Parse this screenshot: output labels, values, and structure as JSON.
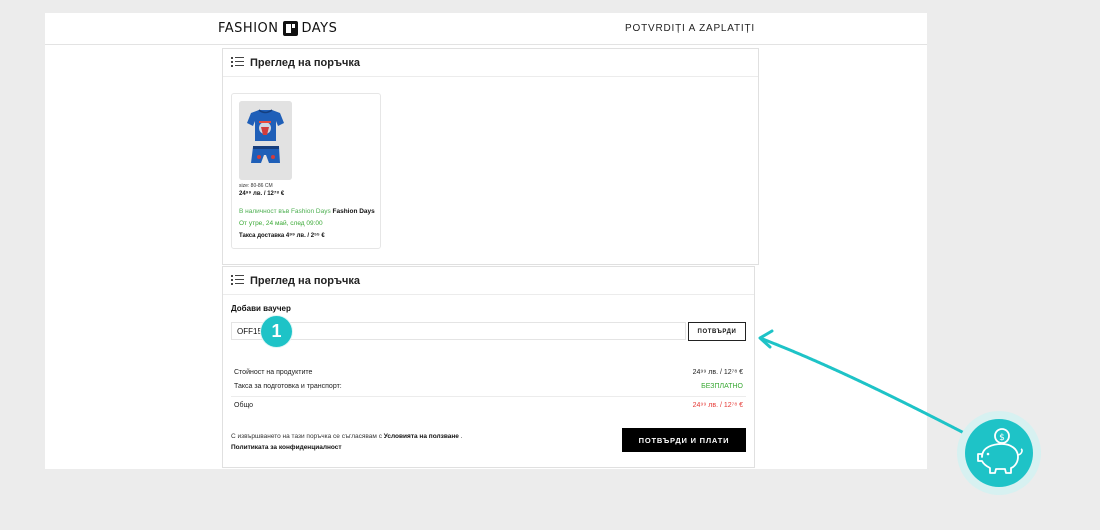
{
  "header": {
    "brand_left": "FASHION",
    "brand_right": "DAYS",
    "step_title": "POTVRDIȚI A ZAPLATIȚI"
  },
  "order_card": {
    "title": "Преглед на поръчка",
    "product": {
      "size": "size: 80-86 CM",
      "price": "24⁹⁹ лв. / 12⁷⁸ €",
      "stock_prefix": "В наличност във Fashion Days",
      "stock_brand": "Fashion Days",
      "delivery": "От утре, 24 май, след 09:00",
      "fee": "Такса доставка 4⁹⁹ лв. / 2⁵⁵ €"
    }
  },
  "summary_card": {
    "title": "Преглед на поръчка",
    "voucher_label": "Добави ваучер",
    "voucher_value": "OFF15",
    "confirm_label": "ПОТВЪРДИ",
    "rows": [
      {
        "label": "Стойност на продуктите",
        "value": "24⁹⁹ лв. / 12⁷⁸ €"
      },
      {
        "label": "Такса за подготовка и транспорт:",
        "value": "БЕЗПЛАТНО"
      },
      {
        "label": "Общо",
        "value": "24⁹⁹ лв. / 12⁷⁸ €"
      }
    ],
    "terms_text": "С извършването на тази поръчка се съгласявам с",
    "terms_link": "Условията на ползване",
    "terms_sep": ".",
    "privacy_link": "Политиката за конфиденциалност",
    "pay_label": "ПОТВЪРДИ И ПЛАТИ"
  },
  "annotation": {
    "step_number": "1"
  },
  "colors": {
    "accent": "#1ec3c7",
    "free": "#3aa935",
    "total": "#e53935"
  },
  "icons": [
    "list-icon",
    "piggy-bank-icon",
    "dollar-coin-icon",
    "arrow-pointer-icon"
  ]
}
